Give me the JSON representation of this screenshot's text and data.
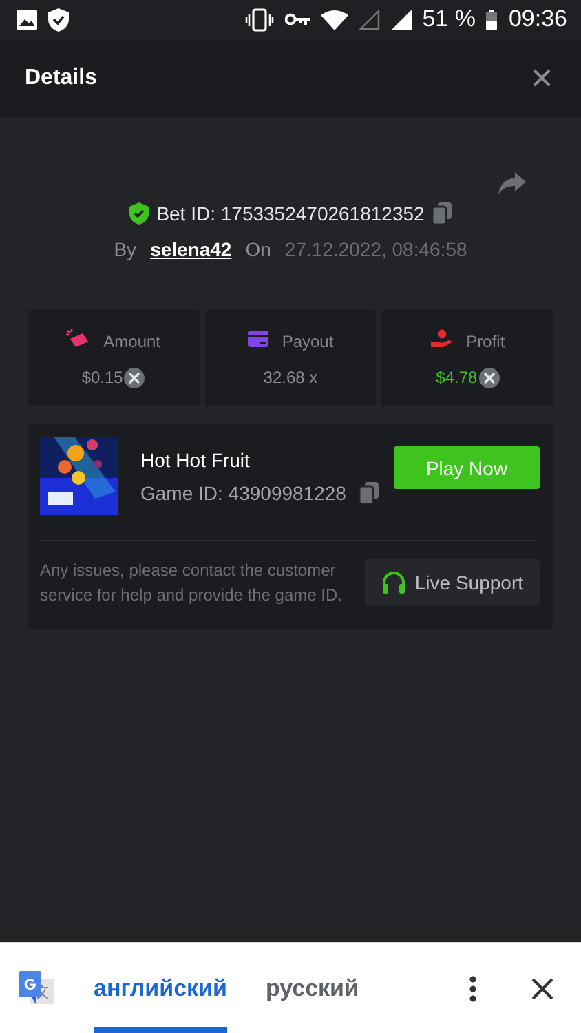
{
  "status_bar": {
    "battery": "51 %",
    "time": "09:36"
  },
  "header": {
    "title": "Details"
  },
  "bet": {
    "id_label": "Bet ID: 1753352470261812352",
    "by_label": "By",
    "user": "selena42",
    "on_label": "On",
    "date": "27.12.2022, 08:46:58"
  },
  "stats": [
    {
      "kind": "amount",
      "label": "Amount",
      "value": "$0.15",
      "currency_badge": true,
      "color": "#e8336e"
    },
    {
      "kind": "payout",
      "label": "Payout",
      "value": "32.68 x",
      "currency_badge": false,
      "color": "#7f45e6"
    },
    {
      "kind": "profit",
      "label": "Profit",
      "value": "$4.78",
      "currency_badge": true,
      "color": "#e32a2a"
    }
  ],
  "game": {
    "name": "Hot Hot Fruit",
    "id_label": "Game ID: 43909981228",
    "play_button": "Play Now"
  },
  "support": {
    "text": "Any issues, please contact the customer service for help and provide the game ID.",
    "button": "Live Support"
  },
  "translate_bar": {
    "languages": [
      {
        "label": "английский",
        "selected": true
      },
      {
        "label": "русский",
        "selected": false
      }
    ]
  }
}
